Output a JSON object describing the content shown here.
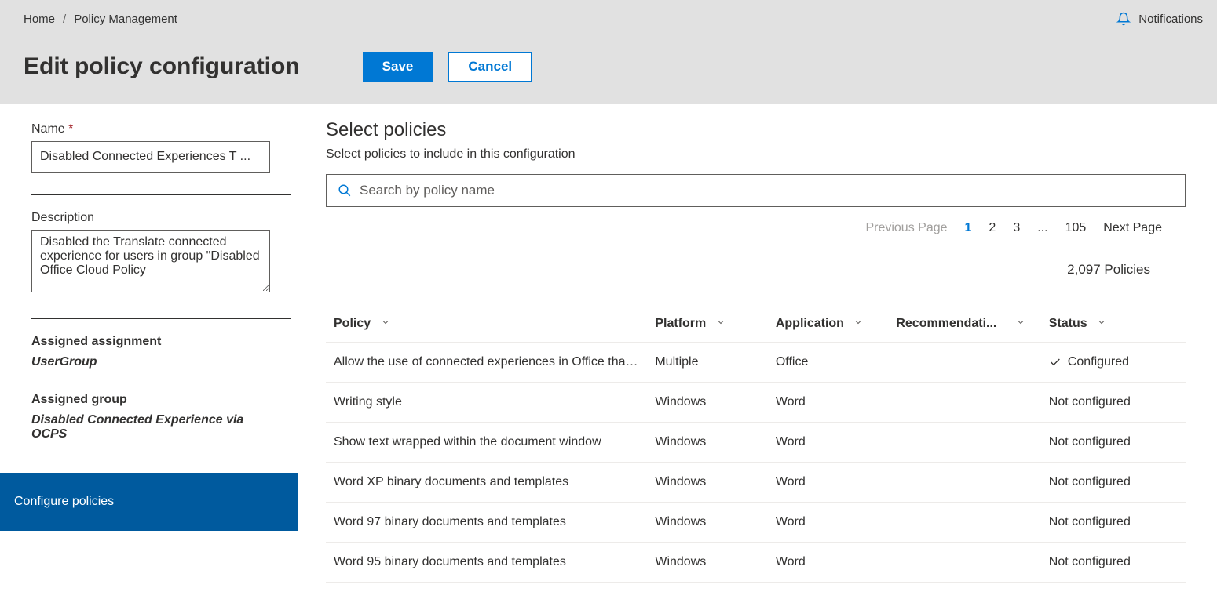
{
  "breadcrumb": {
    "home": "Home",
    "current": "Policy Management"
  },
  "notifications_label": "Notifications",
  "page_title": "Edit policy configuration",
  "buttons": {
    "save": "Save",
    "cancel": "Cancel"
  },
  "form": {
    "name_label": "Name",
    "name_value": "Disabled Connected Experiences T ...",
    "description_label": "Description",
    "description_value": "Disabled the Translate connected experience for users in group \"Disabled Office Cloud Policy",
    "assigned_assignment_label": "Assigned assignment",
    "assigned_assignment_value": "UserGroup",
    "assigned_group_label": "Assigned group",
    "assigned_group_value": "Disabled Connected Experience via OCPS",
    "configure_policies": "Configure policies"
  },
  "main": {
    "section_title": "Select policies",
    "section_sub": "Select policies to include in this configuration",
    "search_placeholder": "Search by policy name",
    "pagination": {
      "prev": "Previous Page",
      "pages": [
        "1",
        "2",
        "3",
        "...",
        "105"
      ],
      "next": "Next Page"
    },
    "policies_count": "2,097 Policies",
    "columns": {
      "policy": "Policy",
      "platform": "Platform",
      "application": "Application",
      "recommendation": "Recommendati...",
      "status": "Status"
    },
    "rows": [
      {
        "policy": "Allow the use of connected experiences in Office that a...",
        "platform": "Multiple",
        "application": "Office",
        "recommendation": "",
        "status": "Configured",
        "configured": true
      },
      {
        "policy": "Writing style",
        "platform": "Windows",
        "application": "Word",
        "recommendation": "",
        "status": "Not configured",
        "configured": false
      },
      {
        "policy": "Show text wrapped within the document window",
        "platform": "Windows",
        "application": "Word",
        "recommendation": "",
        "status": "Not configured",
        "configured": false
      },
      {
        "policy": "Word XP binary documents and templates",
        "platform": "Windows",
        "application": "Word",
        "recommendation": "",
        "status": "Not configured",
        "configured": false
      },
      {
        "policy": "Word 97 binary documents and templates",
        "platform": "Windows",
        "application": "Word",
        "recommendation": "",
        "status": "Not configured",
        "configured": false
      },
      {
        "policy": "Word 95 binary documents and templates",
        "platform": "Windows",
        "application": "Word",
        "recommendation": "",
        "status": "Not configured",
        "configured": false
      }
    ]
  }
}
